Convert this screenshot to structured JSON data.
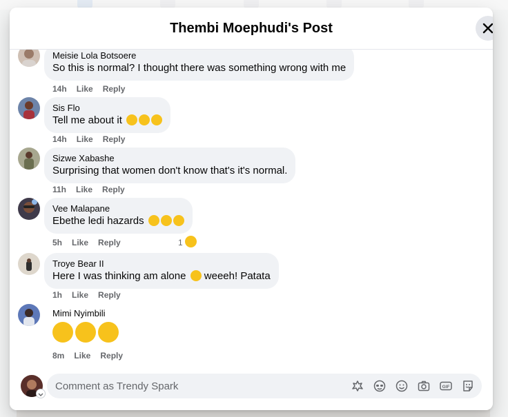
{
  "modal": {
    "title": "Thembi Moephudi's Post"
  },
  "comments": [
    {
      "author": "Meisie Lola Botsoere",
      "text": "So this is normal? I thought there was something wrong with me",
      "time": "14h",
      "like": "Like",
      "reply": "Reply"
    },
    {
      "author": "Sis Flo",
      "text": "Tell me about it",
      "emojis": [
        "rolling-eyes",
        "unamused",
        "unamused"
      ],
      "time": "14h",
      "like": "Like",
      "reply": "Reply"
    },
    {
      "author": "Sizwe Xabashe",
      "text": "Surprising that women don't know that's it's normal.",
      "time": "11h",
      "like": "Like",
      "reply": "Reply"
    },
    {
      "author": "Vee Malapane",
      "text": "Ebethe ledi hazards",
      "emojis": [
        "loudly-crying",
        "loudly-crying",
        "loudly-crying"
      ],
      "time": "5h",
      "like": "Like",
      "reply": "Reply",
      "reaction_count": "1",
      "reaction": "laughing"
    },
    {
      "author": "Troye Bear II",
      "text": "Here I was thinking am alone",
      "emojis": [
        "slightly-smiling"
      ],
      "text_after": "weeeh! Patata",
      "time": "1h",
      "like": "Like",
      "reply": "Reply"
    },
    {
      "author": "Mimi Nyimbili",
      "text": "",
      "emojis": [
        "tears-of-joy",
        "tears-of-joy",
        "tears-of-joy"
      ],
      "time": "8m",
      "like": "Like",
      "reply": "Reply"
    }
  ],
  "composer": {
    "placeholder": "Comment as Trendy Spark",
    "tools": [
      "avatar-sticker-icon",
      "emoji-face-icon",
      "smiley-icon",
      "camera-icon",
      "gif-icon",
      "sticker-icon"
    ]
  },
  "colors": {
    "bubble": "#f0f2f5",
    "meta": "#65676b",
    "divider": "#e4e6eb",
    "emoji": "#f7c21c"
  }
}
